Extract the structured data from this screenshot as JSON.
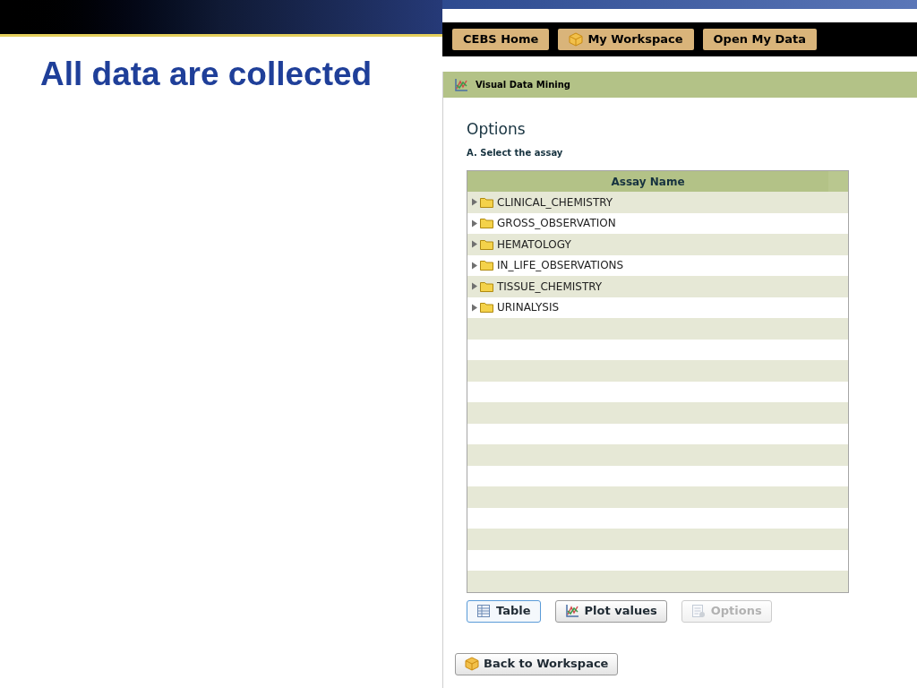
{
  "slide": {
    "title": "All data are collected"
  },
  "nav_buttons": [
    {
      "label": "CEBS Home",
      "icon": false
    },
    {
      "label": "My Workspace",
      "icon": true
    },
    {
      "label": "Open My Data",
      "icon": false
    }
  ],
  "panel": {
    "title": "Visual Data Mining",
    "heading": "Options",
    "step": "A. Select the assay"
  },
  "table": {
    "column": "Assay Name",
    "rows": [
      "CLINICAL_CHEMISTRY",
      "GROSS_OBSERVATION",
      "HEMATOLOGY",
      "IN_LIFE_OBSERVATIONS",
      "TISSUE_CHEMISTRY",
      "URINALYSIS"
    ]
  },
  "view_buttons": [
    {
      "label": "Table",
      "kind": "table",
      "selected": true,
      "disabled": false
    },
    {
      "label": "Plot values",
      "kind": "plot",
      "selected": false,
      "disabled": false
    },
    {
      "label": "Options",
      "kind": "options",
      "selected": false,
      "disabled": true
    }
  ],
  "back_button": "Back to Workspace"
}
